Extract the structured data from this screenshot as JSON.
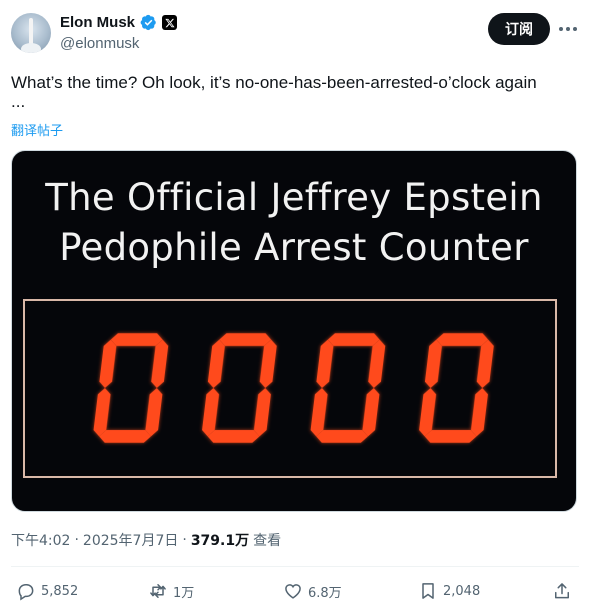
{
  "author": {
    "display_name": "Elon Musk",
    "handle": "@elonmusk",
    "verified_icon": "verified-badge-icon",
    "affiliation_icon": "x-logo-icon"
  },
  "header": {
    "subscribe_label": "订阅",
    "more_icon": "more-horizontal-icon"
  },
  "tweet": {
    "text_line1": "What’s the time? Oh look, it’s no-one-has-been-arrested-o’clock again",
    "text_line2": "...",
    "translate_label": "翻译帖子"
  },
  "media": {
    "title_line1": "The Official Jeffrey Epstein",
    "title_line2": "Pedophile Arrest Counter",
    "counter_value": "0000",
    "digit_color": "#ff4a1c"
  },
  "meta": {
    "time": "下午4:02",
    "sep1": "·",
    "date": "2025年7月7日",
    "sep2": "·",
    "views": "379.1万",
    "views_label": "查看"
  },
  "actions": {
    "replies": "5,852",
    "reposts": "1万",
    "likes": "6.8万",
    "bookmarks": "2,048"
  },
  "colors": {
    "accent": "#1d9bf0",
    "muted": "#536471",
    "text": "#0f1419"
  }
}
